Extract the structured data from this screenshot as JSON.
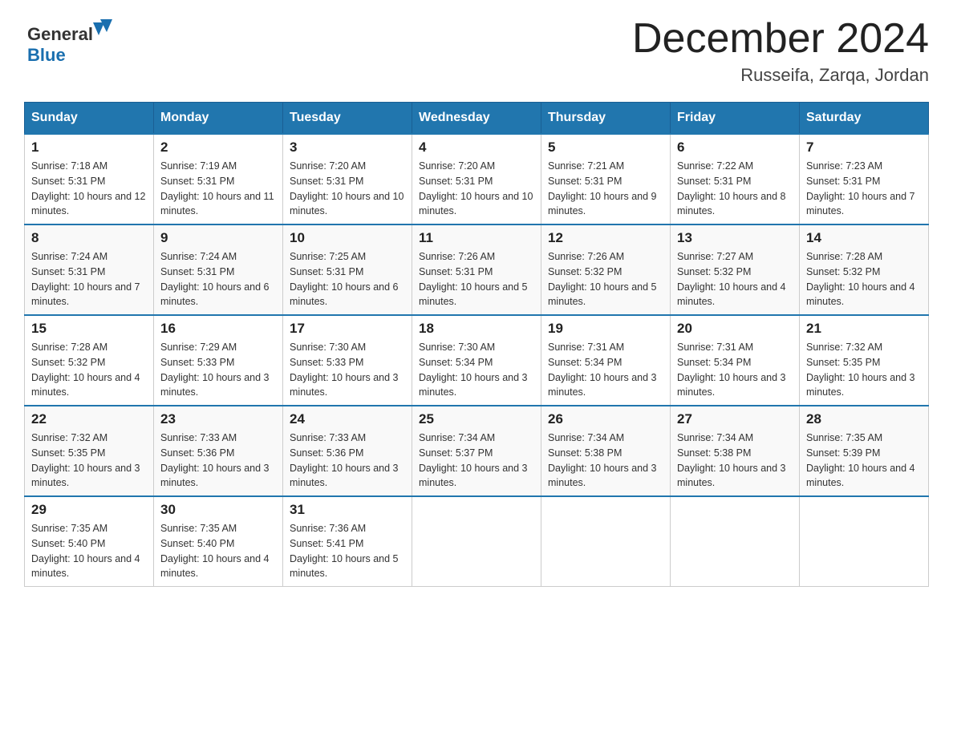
{
  "header": {
    "logo_general": "General",
    "logo_blue": "Blue",
    "month_title": "December 2024",
    "location": "Russeifa, Zarqa, Jordan"
  },
  "days_of_week": [
    "Sunday",
    "Monday",
    "Tuesday",
    "Wednesday",
    "Thursday",
    "Friday",
    "Saturday"
  ],
  "weeks": [
    [
      {
        "day": "1",
        "sunrise": "7:18 AM",
        "sunset": "5:31 PM",
        "daylight": "10 hours and 12 minutes."
      },
      {
        "day": "2",
        "sunrise": "7:19 AM",
        "sunset": "5:31 PM",
        "daylight": "10 hours and 11 minutes."
      },
      {
        "day": "3",
        "sunrise": "7:20 AM",
        "sunset": "5:31 PM",
        "daylight": "10 hours and 10 minutes."
      },
      {
        "day": "4",
        "sunrise": "7:20 AM",
        "sunset": "5:31 PM",
        "daylight": "10 hours and 10 minutes."
      },
      {
        "day": "5",
        "sunrise": "7:21 AM",
        "sunset": "5:31 PM",
        "daylight": "10 hours and 9 minutes."
      },
      {
        "day": "6",
        "sunrise": "7:22 AM",
        "sunset": "5:31 PM",
        "daylight": "10 hours and 8 minutes."
      },
      {
        "day": "7",
        "sunrise": "7:23 AM",
        "sunset": "5:31 PM",
        "daylight": "10 hours and 7 minutes."
      }
    ],
    [
      {
        "day": "8",
        "sunrise": "7:24 AM",
        "sunset": "5:31 PM",
        "daylight": "10 hours and 7 minutes."
      },
      {
        "day": "9",
        "sunrise": "7:24 AM",
        "sunset": "5:31 PM",
        "daylight": "10 hours and 6 minutes."
      },
      {
        "day": "10",
        "sunrise": "7:25 AM",
        "sunset": "5:31 PM",
        "daylight": "10 hours and 6 minutes."
      },
      {
        "day": "11",
        "sunrise": "7:26 AM",
        "sunset": "5:31 PM",
        "daylight": "10 hours and 5 minutes."
      },
      {
        "day": "12",
        "sunrise": "7:26 AM",
        "sunset": "5:32 PM",
        "daylight": "10 hours and 5 minutes."
      },
      {
        "day": "13",
        "sunrise": "7:27 AM",
        "sunset": "5:32 PM",
        "daylight": "10 hours and 4 minutes."
      },
      {
        "day": "14",
        "sunrise": "7:28 AM",
        "sunset": "5:32 PM",
        "daylight": "10 hours and 4 minutes."
      }
    ],
    [
      {
        "day": "15",
        "sunrise": "7:28 AM",
        "sunset": "5:32 PM",
        "daylight": "10 hours and 4 minutes."
      },
      {
        "day": "16",
        "sunrise": "7:29 AM",
        "sunset": "5:33 PM",
        "daylight": "10 hours and 3 minutes."
      },
      {
        "day": "17",
        "sunrise": "7:30 AM",
        "sunset": "5:33 PM",
        "daylight": "10 hours and 3 minutes."
      },
      {
        "day": "18",
        "sunrise": "7:30 AM",
        "sunset": "5:34 PM",
        "daylight": "10 hours and 3 minutes."
      },
      {
        "day": "19",
        "sunrise": "7:31 AM",
        "sunset": "5:34 PM",
        "daylight": "10 hours and 3 minutes."
      },
      {
        "day": "20",
        "sunrise": "7:31 AM",
        "sunset": "5:34 PM",
        "daylight": "10 hours and 3 minutes."
      },
      {
        "day": "21",
        "sunrise": "7:32 AM",
        "sunset": "5:35 PM",
        "daylight": "10 hours and 3 minutes."
      }
    ],
    [
      {
        "day": "22",
        "sunrise": "7:32 AM",
        "sunset": "5:35 PM",
        "daylight": "10 hours and 3 minutes."
      },
      {
        "day": "23",
        "sunrise": "7:33 AM",
        "sunset": "5:36 PM",
        "daylight": "10 hours and 3 minutes."
      },
      {
        "day": "24",
        "sunrise": "7:33 AM",
        "sunset": "5:36 PM",
        "daylight": "10 hours and 3 minutes."
      },
      {
        "day": "25",
        "sunrise": "7:34 AM",
        "sunset": "5:37 PM",
        "daylight": "10 hours and 3 minutes."
      },
      {
        "day": "26",
        "sunrise": "7:34 AM",
        "sunset": "5:38 PM",
        "daylight": "10 hours and 3 minutes."
      },
      {
        "day": "27",
        "sunrise": "7:34 AM",
        "sunset": "5:38 PM",
        "daylight": "10 hours and 3 minutes."
      },
      {
        "day": "28",
        "sunrise": "7:35 AM",
        "sunset": "5:39 PM",
        "daylight": "10 hours and 4 minutes."
      }
    ],
    [
      {
        "day": "29",
        "sunrise": "7:35 AM",
        "sunset": "5:40 PM",
        "daylight": "10 hours and 4 minutes."
      },
      {
        "day": "30",
        "sunrise": "7:35 AM",
        "sunset": "5:40 PM",
        "daylight": "10 hours and 4 minutes."
      },
      {
        "day": "31",
        "sunrise": "7:36 AM",
        "sunset": "5:41 PM",
        "daylight": "10 hours and 5 minutes."
      },
      null,
      null,
      null,
      null
    ]
  ]
}
